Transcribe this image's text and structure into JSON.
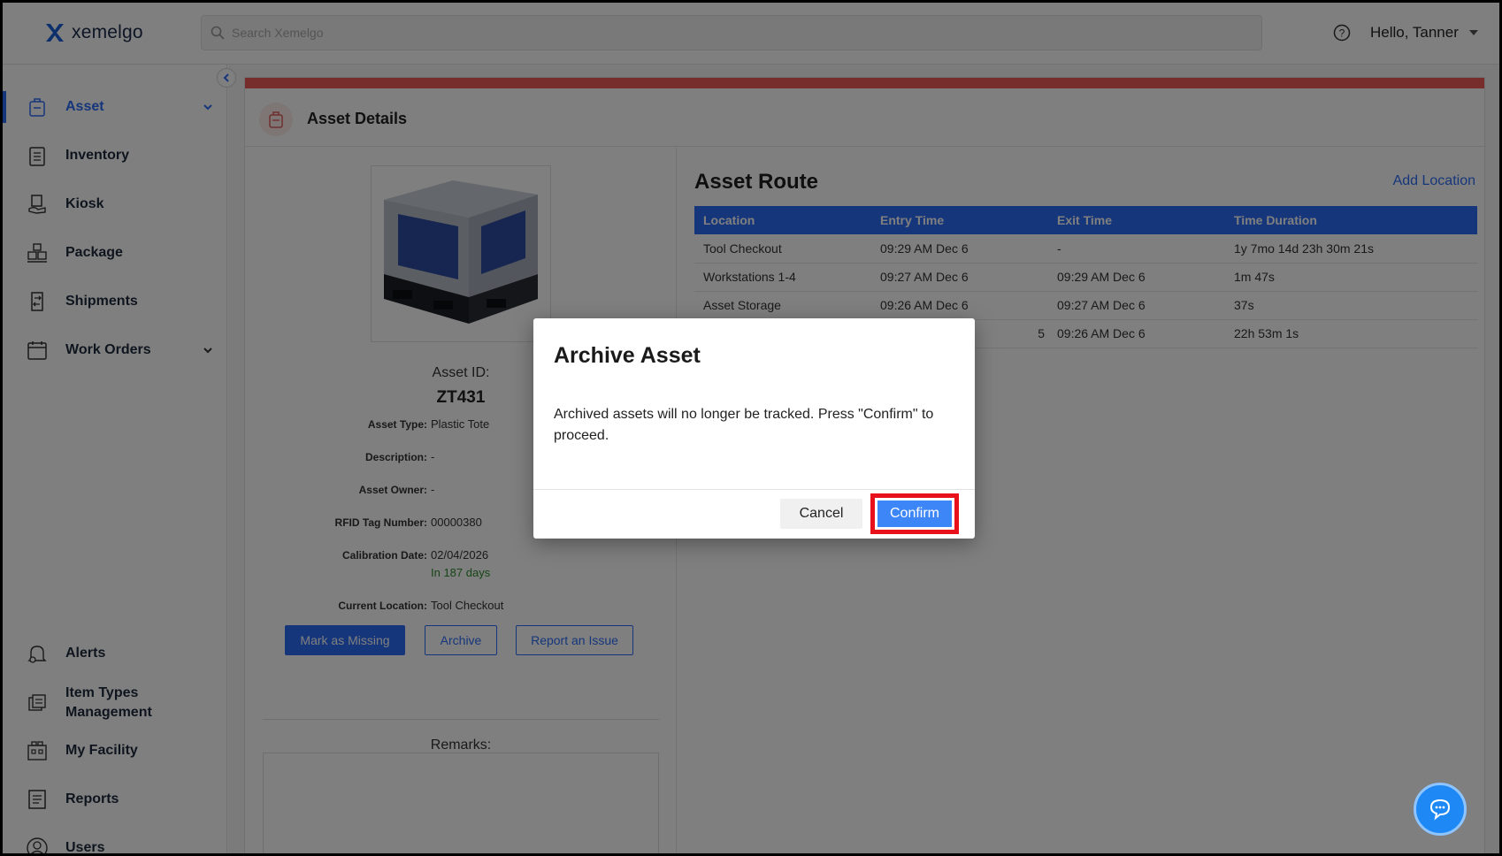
{
  "app": {
    "name": "xemelgo"
  },
  "header": {
    "search_placeholder": "Search Xemelgo",
    "greeting": "Hello, Tanner"
  },
  "sidebar": {
    "items": [
      {
        "label": "Asset",
        "icon": "asset-icon",
        "active": true
      },
      {
        "label": "Inventory",
        "icon": "clipboard-icon"
      },
      {
        "label": "Kiosk",
        "icon": "kiosk-icon"
      },
      {
        "label": "Package",
        "icon": "package-icon"
      },
      {
        "label": "Shipments",
        "icon": "shipments-icon"
      },
      {
        "label": "Work Orders",
        "icon": "calendar-icon"
      },
      {
        "label": "Alerts",
        "icon": "bell-icon"
      },
      {
        "label": "Item Types Management",
        "icon": "item-types-icon"
      },
      {
        "label": "My Facility",
        "icon": "facility-icon"
      },
      {
        "label": "Reports",
        "icon": "reports-icon"
      },
      {
        "label": "Users",
        "icon": "user-icon"
      }
    ]
  },
  "page": {
    "title": "Asset Details",
    "asset": {
      "id_label": "Asset ID:",
      "id": "ZT431",
      "fields": [
        {
          "key": "Asset Type:",
          "value": "Plastic Tote"
        },
        {
          "key": "Description:",
          "value": "-"
        },
        {
          "key": "Asset Owner:",
          "value": "-"
        },
        {
          "key": "RFID Tag Number:",
          "value": "00000380"
        },
        {
          "key": "Calibration Date:",
          "value": "02/04/2026",
          "sub": "In 187 days"
        },
        {
          "key": "Current Location:",
          "value": "Tool Checkout"
        }
      ]
    },
    "actions": {
      "mark_missing": "Mark as Missing",
      "archive": "Archive",
      "report_issue": "Report an Issue"
    },
    "remarks_label": "Remarks:",
    "route": {
      "title": "Asset Route",
      "add_location": "Add Location",
      "columns": [
        "Location",
        "Entry Time",
        "Exit Time",
        "Time Duration"
      ],
      "rows": [
        [
          "Tool Checkout",
          "09:29 AM Dec 6",
          "-",
          "1y 7mo 14d 23h 30m 21s"
        ],
        [
          "Workstations 1-4",
          "09:27 AM Dec 6",
          "09:29 AM Dec 6",
          "1m 47s"
        ],
        [
          "Asset Storage",
          "09:26 AM Dec 6",
          "09:27 AM Dec 6",
          "37s"
        ],
        [
          "",
          "5",
          "09:26 AM Dec 6",
          "22h 53m 1s"
        ]
      ]
    }
  },
  "modal": {
    "title": "Archive Asset",
    "body": "Archived assets will no longer be tracked. Press \"Confirm\" to proceed.",
    "cancel": "Cancel",
    "confirm": "Confirm"
  },
  "colors": {
    "accent": "#2d6cf6",
    "header_bar": "#f05a5a",
    "highlight": "#e8101b"
  }
}
